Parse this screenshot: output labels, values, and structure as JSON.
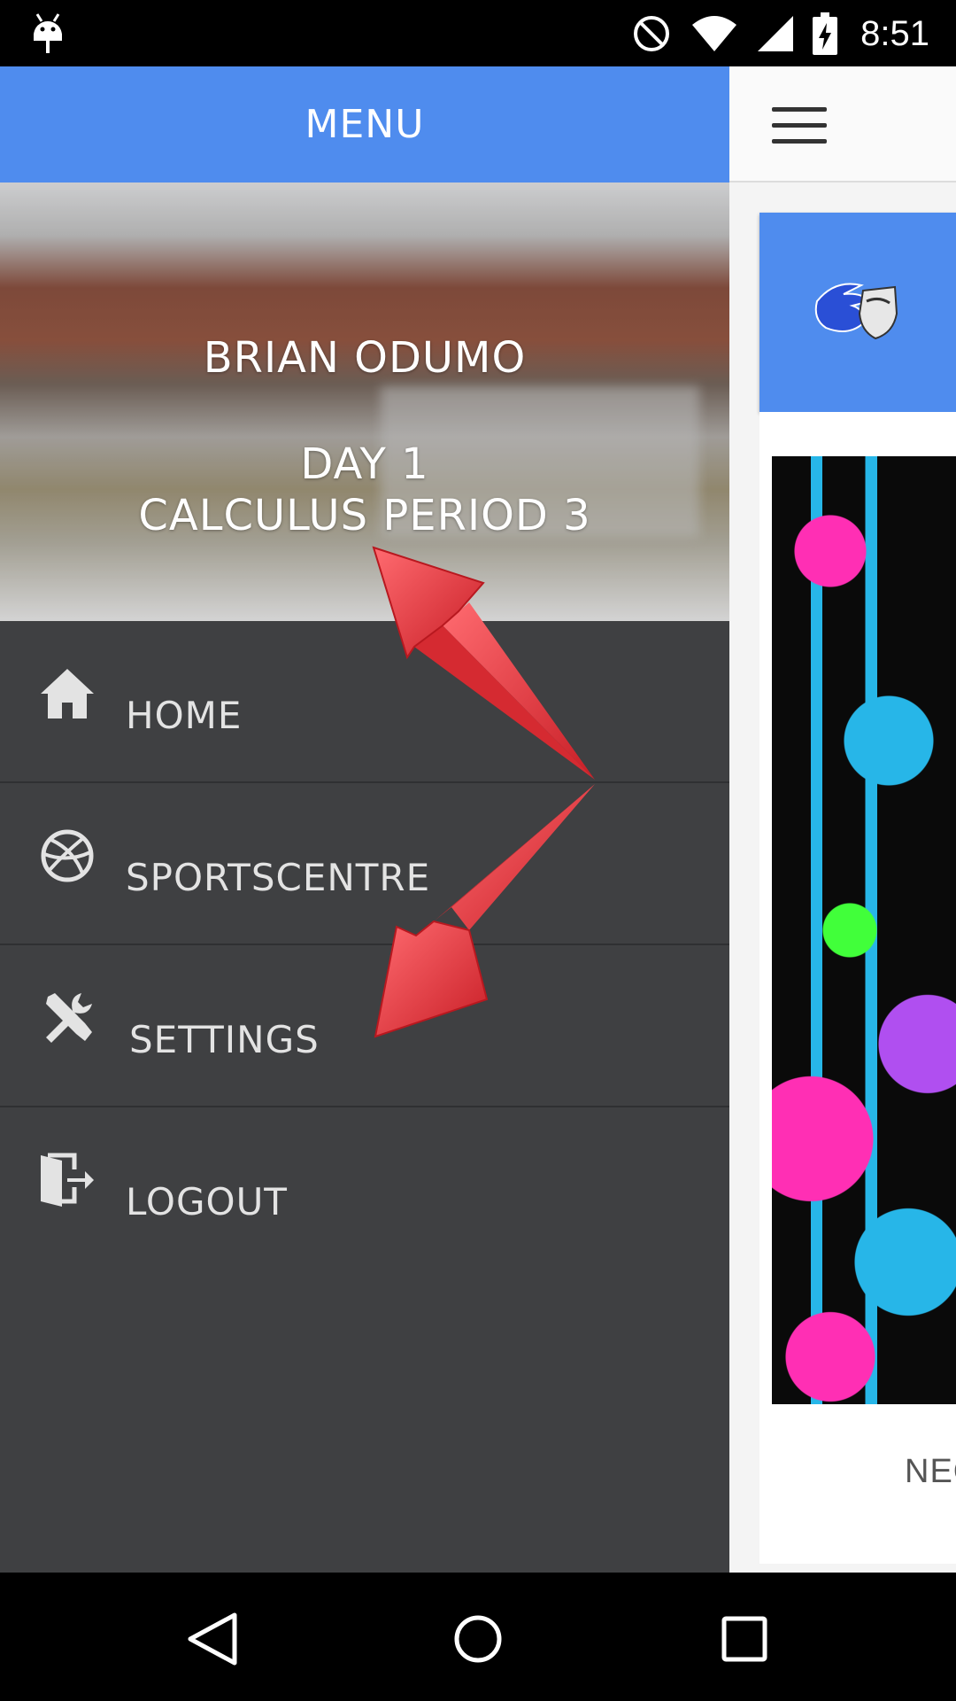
{
  "status_bar": {
    "time": "8:51",
    "icons": [
      "android-debug-icon",
      "do-not-disturb-icon",
      "wifi-icon",
      "cell-signal-icon",
      "battery-charging-icon"
    ]
  },
  "drawer": {
    "title": "MENU",
    "accent_color": "#4f8cee",
    "background_color": "#3f4042",
    "profile": {
      "name": "BRIAN ODUMO",
      "day": "DAY 1",
      "period": "CALCULUS PERIOD 3"
    },
    "items": [
      {
        "label": "HOME",
        "icon": "home-icon"
      },
      {
        "label": "SPORTSCENTRE",
        "icon": "basketball-icon"
      },
      {
        "label": "SETTINGS",
        "icon": "tools-icon"
      },
      {
        "label": "LOGOUT",
        "icon": "logout-icon"
      }
    ]
  },
  "main": {
    "news_label": "NEC"
  },
  "annotation": {
    "color": "#e8333a"
  }
}
